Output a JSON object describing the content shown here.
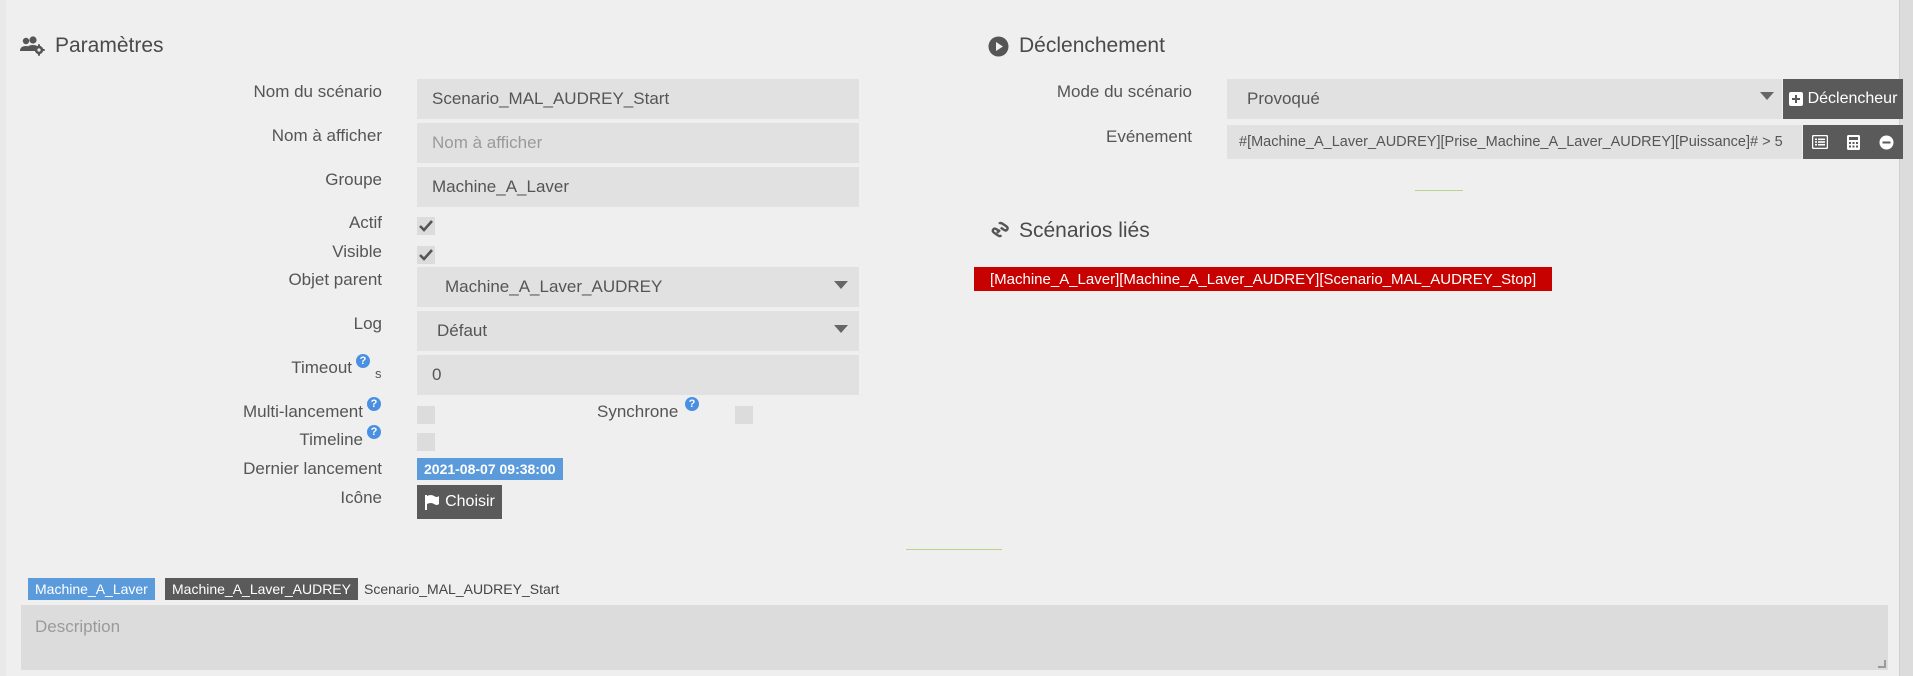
{
  "parametres": {
    "title": "Paramètres",
    "fields": {
      "nom_label": "Nom du scénario",
      "nom_value": "Scenario_MAL_AUDREY_Start",
      "afficher_label": "Nom à afficher",
      "afficher_placeholder": "Nom à afficher",
      "groupe_label": "Groupe",
      "groupe_value": "Machine_A_Laver",
      "actif_label": "Actif",
      "visible_label": "Visible",
      "parent_label": "Objet parent",
      "parent_value": "Machine_A_Laver_AUDREY",
      "log_label": "Log",
      "log_value": "Défaut",
      "timeout_label": "Timeout",
      "timeout_unit": "s",
      "timeout_value": "0",
      "multi_label": "Multi-lancement",
      "synchrone_label": "Synchrone",
      "timeline_label": "Timeline",
      "dernier_label": "Dernier lancement",
      "dernier_value": "2021-08-07 09:38:00",
      "icone_label": "Icône",
      "choisir_label": "Choisir"
    },
    "help_glyph": "?"
  },
  "declenchement": {
    "title": "Déclenchement",
    "mode_label": "Mode du scénario",
    "mode_value": "Provoqué",
    "declencheur_label": "Déclencheur",
    "evenement_label": "Evénement",
    "evenement_value": "#[Machine_A_Laver_AUDREY][Prise_Machine_A_Laver_AUDREY][Puissance]# > 5"
  },
  "lies": {
    "title": "Scénarios liés",
    "items": [
      "[Machine_A_Laver][Machine_A_Laver_AUDREY][Scenario_MAL_AUDREY_Stop]"
    ]
  },
  "breadcrumb": {
    "group": "Machine_A_Laver",
    "object": "Machine_A_Laver_AUDREY",
    "scenario": "Scenario_MAL_AUDREY_Start"
  },
  "description": {
    "placeholder": "Description"
  },
  "colors": {
    "accent_blue": "#5b9bdc",
    "link_red": "#c70000",
    "button_dark": "#5a5a5a",
    "field_bg": "#e1e1e1"
  },
  "icons": {
    "parametres": "users-cog-icon",
    "declenchement": "play-circle-icon",
    "lies": "link-icon",
    "choisir": "flag-icon",
    "declencheur": "plus-square-icon",
    "evenement_actions": [
      "list-icon",
      "calculator-icon",
      "minus-circle-icon"
    ]
  }
}
